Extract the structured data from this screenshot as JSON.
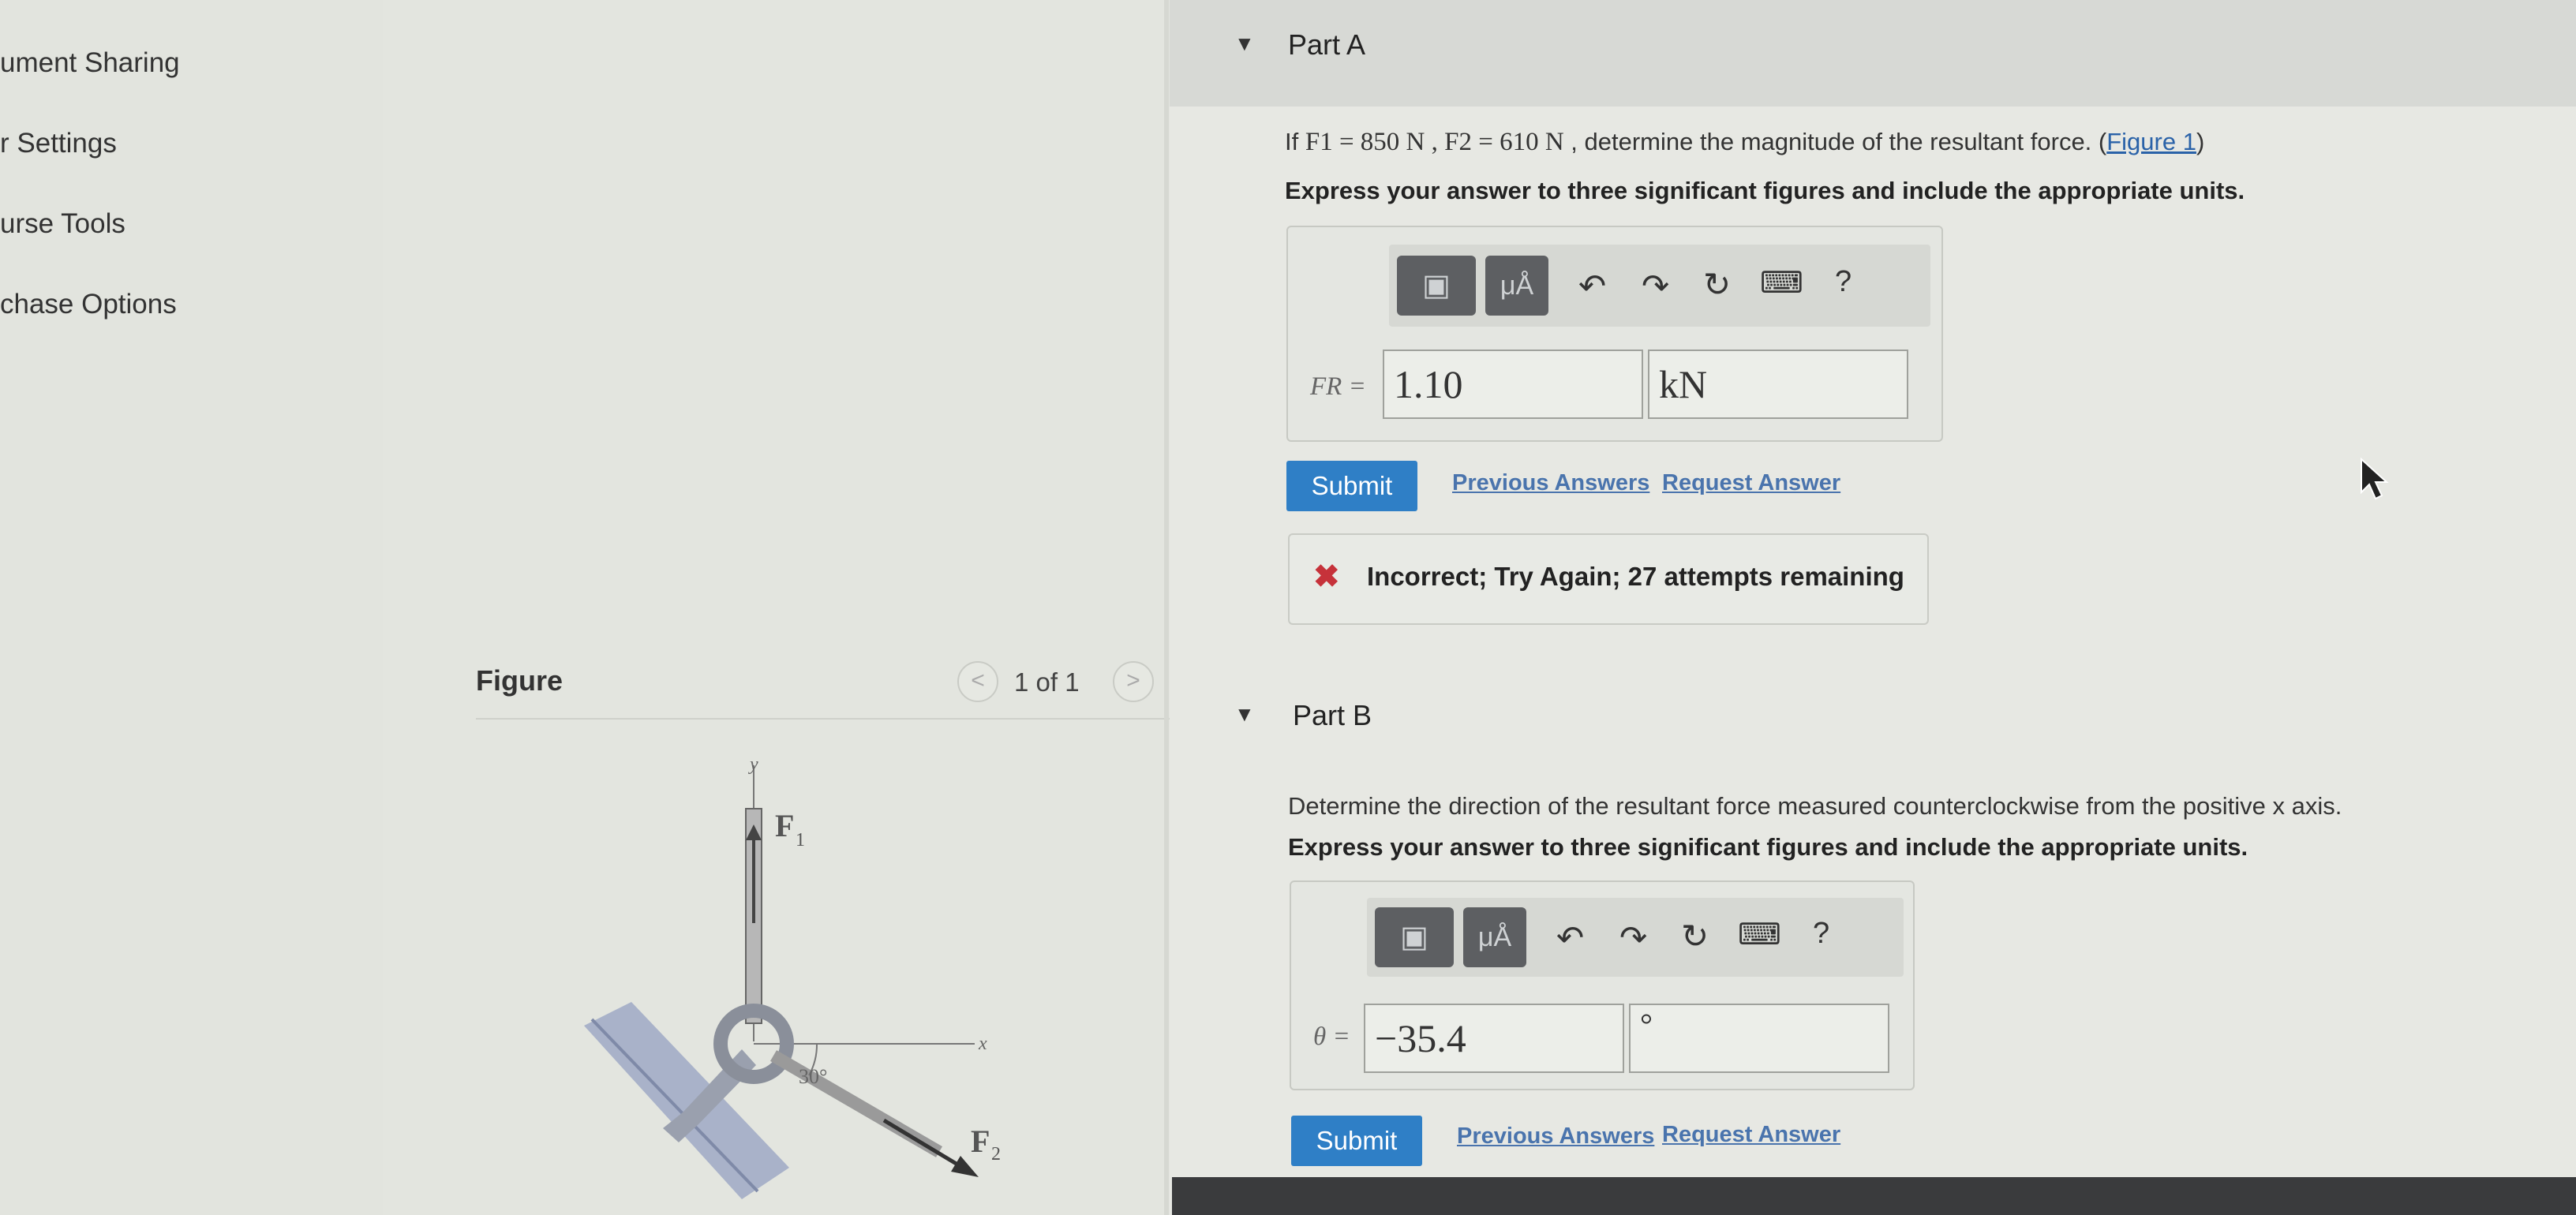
{
  "left_nav": {
    "items": [
      {
        "label": "ument Sharing"
      },
      {
        "label": "r Settings"
      },
      {
        "label": "urse Tools"
      },
      {
        "label": "chase Options"
      }
    ]
  },
  "figure": {
    "title": "Figure",
    "pager": {
      "label": "1 of 1",
      "prev": "<",
      "next": ">"
    },
    "labels": {
      "y_axis": "y",
      "x_axis": "x",
      "f1": "F",
      "f1_sub": "1",
      "f2": "F",
      "f2_sub": "2",
      "angle": "30°"
    }
  },
  "partA": {
    "title": "Part A",
    "question_prefix": "If ",
    "question_math": "F1 = 850 N , F2 = 610 N",
    "question_suffix": " , determine the magnitude of the resultant force. (",
    "figure_link": "Figure 1",
    "question_close": ")",
    "instruction": "Express your answer to three significant figures and include the appropriate units.",
    "toolbar": {
      "mu_label": "μÅ",
      "help": "?"
    },
    "var_label": "FR =",
    "value": "1.10",
    "unit": "kN",
    "submit": "Submit",
    "previous_answers": "Previous Answers",
    "request_answer": "Request Answer",
    "feedback": {
      "icon": "✖",
      "text": "Incorrect; Try Again; 27 attempts remaining"
    }
  },
  "partB": {
    "title": "Part B",
    "question": "Determine the direction of the resultant force measured counterclockwise from the positive x axis.",
    "instruction": "Express your answer to three significant figures and include the appropriate units.",
    "toolbar": {
      "mu_label": "μÅ",
      "help": "?"
    },
    "var_label": "θ =",
    "value": "−35.4",
    "unit": "°",
    "submit": "Submit",
    "previous_answers": "Previous Answers",
    "request_answer": "Request Answer"
  },
  "colors": {
    "accent": "#2f7fc6",
    "error": "#c6323a",
    "link": "#2a62a8"
  }
}
